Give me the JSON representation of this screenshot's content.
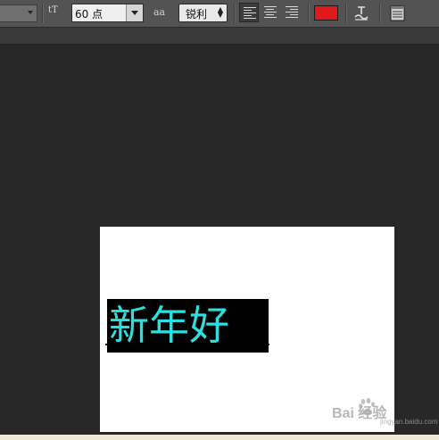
{
  "toolbar": {
    "font_family_value": "",
    "font_size_icon": "tT",
    "font_size_value": "60 点",
    "anti_alias_icon": "aa",
    "anti_alias_value": "锐利",
    "text_color": "#e0191c",
    "align_buttons": [
      "align-left",
      "align-center",
      "align-right"
    ],
    "active_align": "align-left"
  },
  "document": {
    "canvas_color": "#ffffff",
    "text_layer": {
      "text": "新年好",
      "color": "#2de0e0",
      "highlight": "#000000"
    }
  },
  "watermark": {
    "text": "Bai  经验",
    "sub": "jingyan.baidu.com"
  }
}
